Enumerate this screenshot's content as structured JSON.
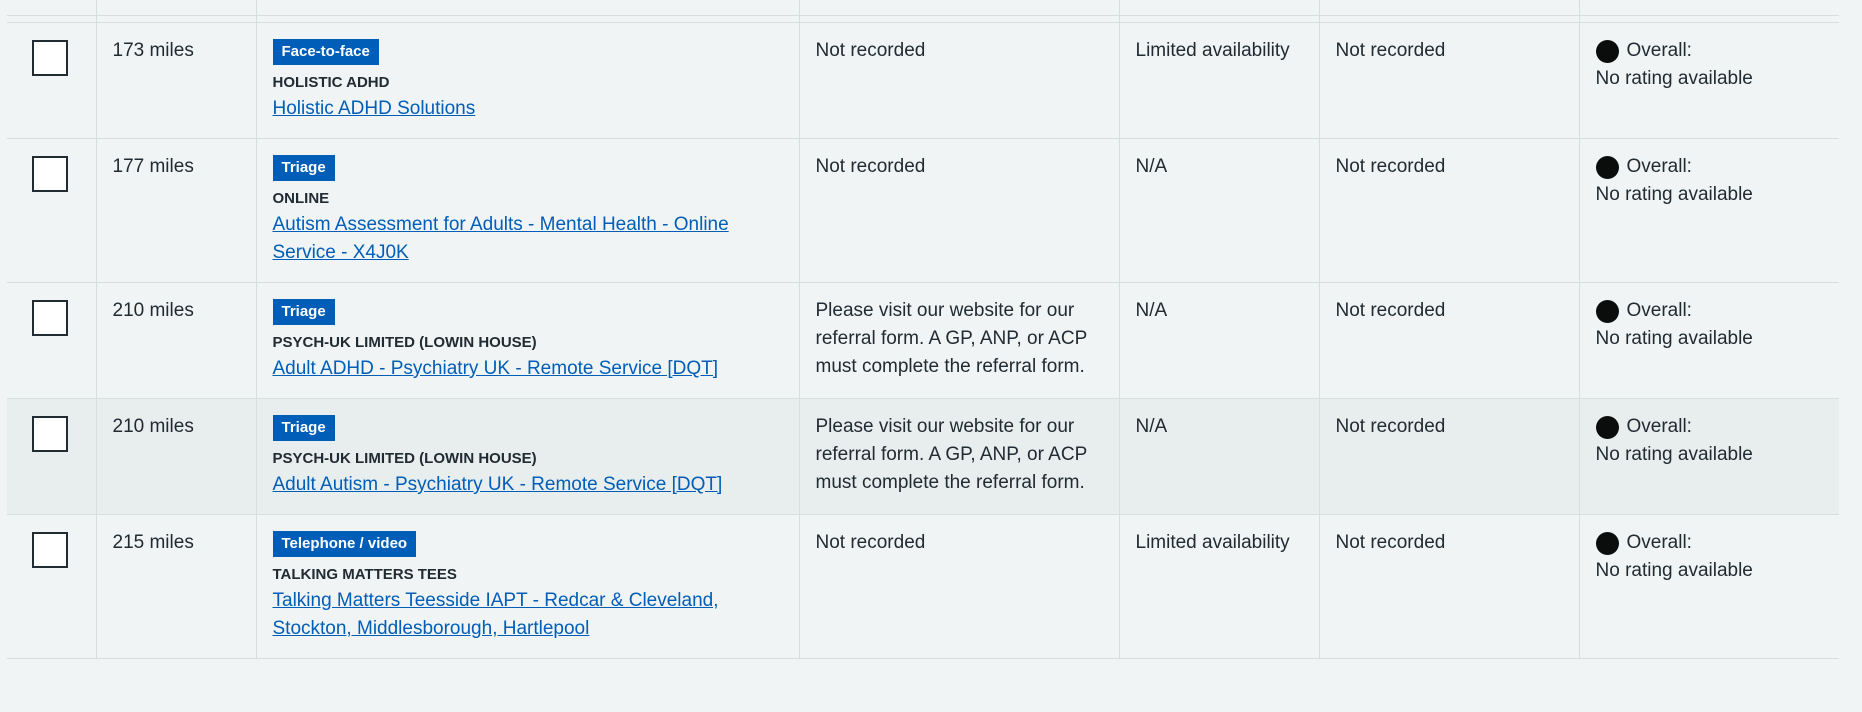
{
  "rows": [
    {
      "distance": "173 miles",
      "tag": "Face-to-face",
      "org": "HOLISTIC ADHD",
      "service_name": "Holistic ADHD Solutions",
      "referral": "Not recorded",
      "wait": "Limited availability",
      "recommend": "Not recorded",
      "rating_label": "Overall:",
      "rating_value": "No rating available"
    },
    {
      "distance": "177 miles",
      "tag": "Triage",
      "org": "ONLINE",
      "service_name": "Autism Assessment for Adults - Mental Health - Online Service - X4J0K",
      "referral": "Not recorded",
      "wait": "N/A",
      "recommend": "Not recorded",
      "rating_label": "Overall:",
      "rating_value": "No rating available"
    },
    {
      "distance": "210 miles",
      "tag": "Triage",
      "org": "PSYCH-UK LIMITED (LOWIN HOUSE)",
      "service_name": "Adult ADHD - Psychiatry UK - Remote Service [DQT]",
      "referral": "Please visit our website for our referral form. A GP, ANP, or ACP must complete the referral form.",
      "wait": "N/A",
      "recommend": "Not recorded",
      "rating_label": "Overall:",
      "rating_value": "No rating available"
    },
    {
      "distance": "210 miles",
      "tag": "Triage",
      "org": "PSYCH-UK LIMITED (LOWIN HOUSE)",
      "service_name": "Adult Autism - Psychiatry UK - Remote Service [DQT]",
      "referral": "Please visit our website for our referral form. A GP, ANP, or ACP must complete the referral form.",
      "wait": "N/A",
      "recommend": "Not recorded",
      "rating_label": "Overall:",
      "rating_value": "No rating available"
    },
    {
      "distance": "215 miles",
      "tag": "Telephone / video",
      "org": "TALKING MATTERS TEES",
      "service_name": "Talking Matters Teesside IAPT - Redcar & Cleveland, Stockton, Middlesborough, Hartlepool",
      "referral": "Not recorded",
      "wait": "Limited availability",
      "recommend": "Not recorded",
      "rating_label": "Overall:",
      "rating_value": "No rating available"
    }
  ],
  "colors": {
    "tag_bg": "#005eb8",
    "link": "#005eb8",
    "row_bg": "#f0f4f5",
    "row_highlight_bg": "#e8edee",
    "border": "#d8dde0",
    "rating_dot": "#0b0c0c"
  },
  "icons": {
    "rating": "rating-dot-icon"
  }
}
